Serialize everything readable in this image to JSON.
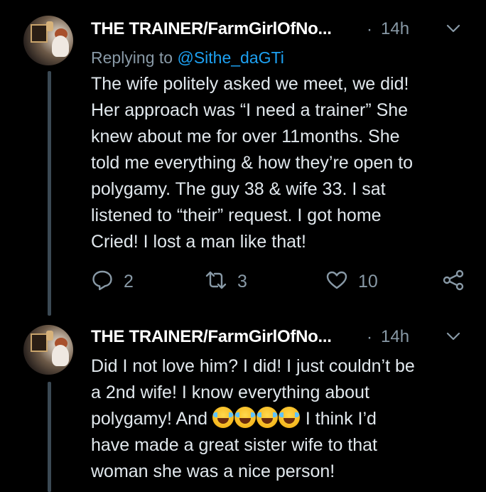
{
  "tweets": [
    {
      "author": "THE TRAINER/FarmGirlOfNo...",
      "separator": "·",
      "time": "14h",
      "reply_prefix": "Replying to ",
      "reply_handle": "@Sithe_daGTi",
      "lines": [
        "The wife politely asked we meet, we did!",
        "Her approach was “I need a trainer” She",
        "knew about me for over 11months. She",
        "told me everything & how they’re open to",
        "polygamy. The guy 38 & wife 33. I sat",
        "listened to “their” request. I got home",
        "Cried! I lost a man like that!"
      ],
      "replies": "2",
      "retweets": "3",
      "likes": "10"
    },
    {
      "author": "THE TRAINER/FarmGirlOfNo...",
      "separator": "·",
      "time": "14h",
      "lines": [
        "Did I not love him? I did! I just couldn’t be",
        "a 2nd wife! I know everything about",
        "polygamy! And ",
        " I think I’d",
        "have made a great sister wife to that",
        "woman she was a nice person!"
      ],
      "emoji_name": "face-with-tears-of-joy",
      "emoji_count": 4
    }
  ],
  "icons": [
    "avatar",
    "chevron-down-icon",
    "reply-icon",
    "retweet-icon",
    "like-icon",
    "share-icon"
  ],
  "colors": {
    "background": "#000000",
    "name": "#ffffff",
    "text": "#e1e8ed",
    "secondary": "#8899a6",
    "link": "#1da1f2",
    "thread_line": "#3b4954"
  }
}
